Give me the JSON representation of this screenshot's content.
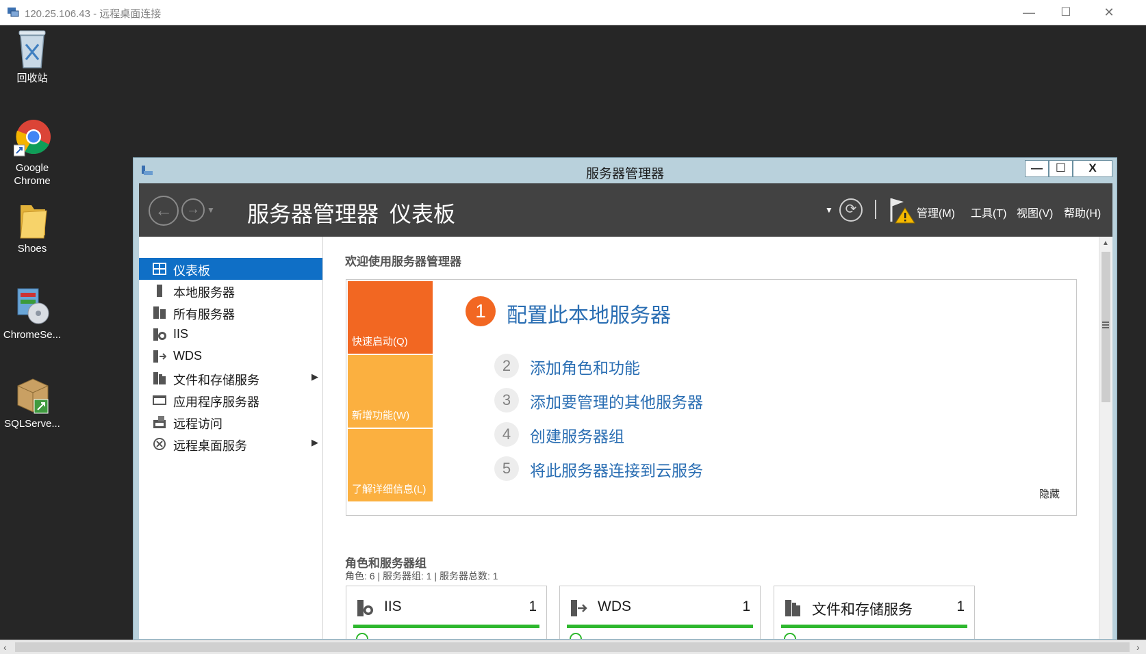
{
  "rdp": {
    "title": "120.25.106.43 - 远程桌面连接",
    "minimize": "—",
    "maximize": "☐",
    "close": "✕"
  },
  "desktop_icons": [
    {
      "label": "回收站",
      "icon": "recycle-bin-icon"
    },
    {
      "label": "Google\nChrome",
      "label_line1": "Google",
      "label_line2": "Chrome",
      "icon": "chrome-icon"
    },
    {
      "label": "Shoes",
      "icon": "folder-icon"
    },
    {
      "label": "ChromeSe...",
      "icon": "installer-disc-icon"
    },
    {
      "label": "SQLServe...",
      "icon": "package-shortcut-icon"
    }
  ],
  "server_manager": {
    "title": "服务器管理器",
    "win_min": "—",
    "win_max": "☐",
    "win_close": "X",
    "breadcrumb_root": "服务器管理器",
    "breadcrumb_sep": "‣",
    "breadcrumb_current": "仪表板",
    "menus": {
      "manage": "管理(M)",
      "tools": "工具(T)",
      "view": "视图(V)",
      "help": "帮助(H)"
    },
    "nav": [
      {
        "label": "仪表板",
        "icon": "dashboard-icon",
        "active": true
      },
      {
        "label": "本地服务器",
        "icon": "local-server-icon"
      },
      {
        "label": "所有服务器",
        "icon": "all-servers-icon"
      },
      {
        "label": "IIS",
        "icon": "iis-icon"
      },
      {
        "label": "WDS",
        "icon": "wds-icon"
      },
      {
        "label": "文件和存储服务",
        "icon": "file-storage-icon",
        "has_children": true
      },
      {
        "label": "应用程序服务器",
        "icon": "app-server-icon"
      },
      {
        "label": "远程访问",
        "icon": "remote-access-icon"
      },
      {
        "label": "远程桌面服务",
        "icon": "remote-desktop-icon",
        "has_children": true
      }
    ],
    "welcome_title": "欢迎使用服务器管理器",
    "tiles": {
      "quick_start": "快速启动(Q)",
      "whats_new": "新增功能(W)",
      "learn_more": "了解详细信息(L)"
    },
    "steps": [
      {
        "num": "1",
        "label": "配置此本地服务器"
      },
      {
        "num": "2",
        "label": "添加角色和功能"
      },
      {
        "num": "3",
        "label": "添加要管理的其他服务器"
      },
      {
        "num": "4",
        "label": "创建服务器组"
      },
      {
        "num": "5",
        "label": "将此服务器连接到云服务"
      }
    ],
    "hide_label": "隐藏",
    "roles_title": "角色和服务器组",
    "roles_summary": "角色: 6 | 服务器组: 1 | 服务器总数: 1",
    "role_cards": [
      {
        "name": "IIS",
        "count": "1",
        "icon": "iis-icon"
      },
      {
        "name": "WDS",
        "count": "1",
        "icon": "wds-icon"
      },
      {
        "name": "文件和存储服务",
        "count": "1",
        "icon": "file-storage-icon"
      }
    ],
    "colors": {
      "accent_orange": "#f26722",
      "tile_orange": "#fbb040",
      "link_blue": "#2a6eb3",
      "nav_active": "#0f6fc6",
      "header_bg": "#424242",
      "status_green": "#2eb82e"
    }
  }
}
